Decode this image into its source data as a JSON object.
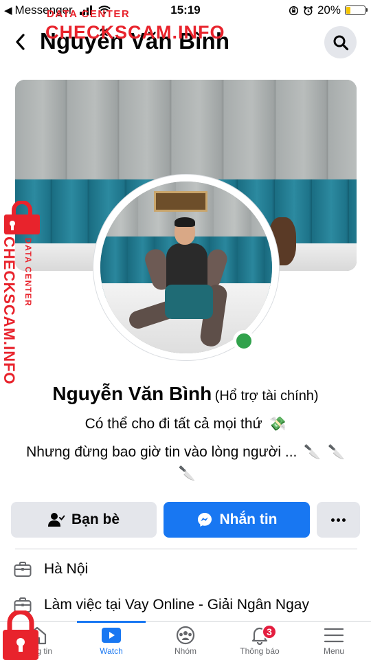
{
  "status_bar": {
    "back_app": "Messenger",
    "time": "15:19",
    "battery_percent": "20%",
    "battery_level": 0.2
  },
  "header": {
    "title": "Nguyễn Văn Bình",
    "back_icon": "chevron-left-icon",
    "search_icon": "search-icon"
  },
  "profile": {
    "name": "Nguyễn Văn Bình",
    "tagline": "(Hổ trợ tài chính)",
    "bio_line_1": "Có thể cho đi tất cả mọi thứ",
    "bio_line_2": "Nhưng đừng bao giờ tin vào lòng người ...",
    "online": true,
    "online_color": "#31a24c"
  },
  "actions": {
    "friends_label": "Bạn bè",
    "message_label": "Nhắn tin",
    "message_color": "#1877f2"
  },
  "info": [
    {
      "icon": "briefcase-icon",
      "text": "Hà Nội"
    },
    {
      "icon": "briefcase-icon",
      "text": "Làm việc tại Vay Online - Giải Ngân Ngay"
    }
  ],
  "tabs": [
    {
      "icon": "home-icon",
      "label": "Bảng tin"
    },
    {
      "icon": "watch-icon",
      "label": "Watch",
      "active": true
    },
    {
      "icon": "groups-icon",
      "label": "Nhóm"
    },
    {
      "icon": "bell-icon",
      "label": "Thông báo",
      "badge": "3"
    },
    {
      "icon": "menu-icon",
      "label": "Menu"
    }
  ],
  "watermark": {
    "brand": "CHECKSCAM.INFO",
    "subtitle": "DATA CENTER",
    "color": "#e8232c"
  }
}
